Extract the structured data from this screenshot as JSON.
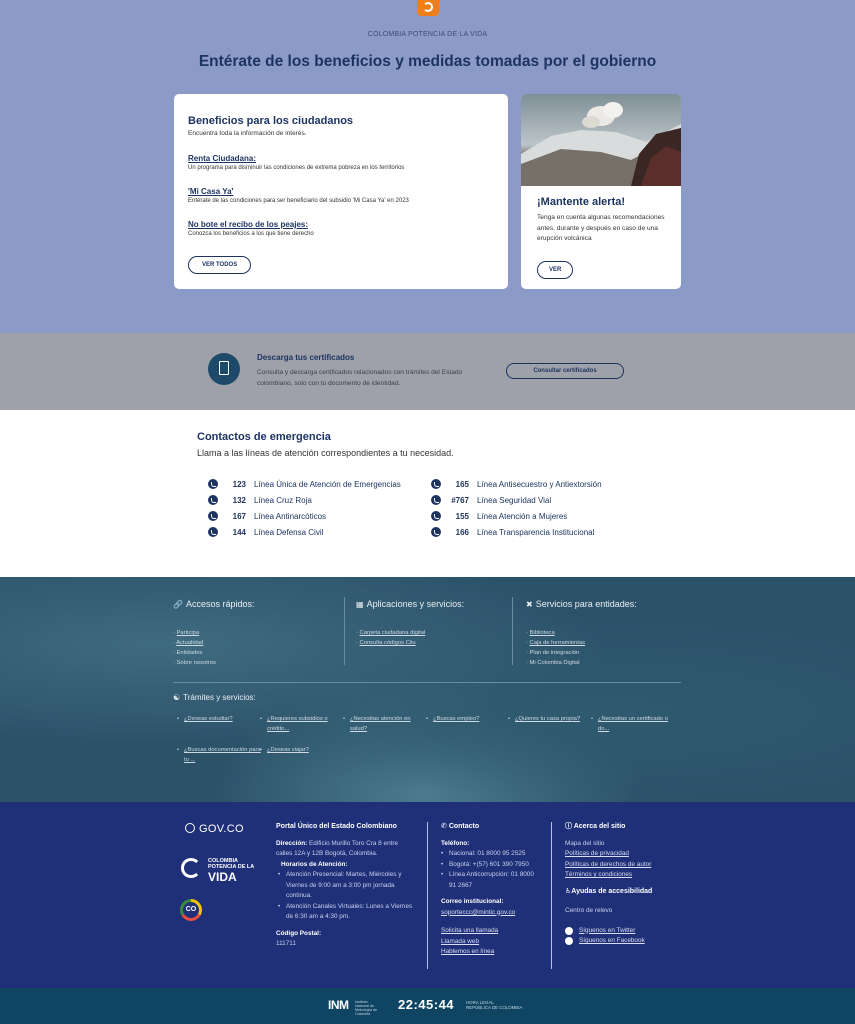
{
  "hero": {
    "tagline": "COLOMBIA POTENCIA DE LA VIDA",
    "title": "Entérate de los beneficios y medidas tomadas por el gobierno"
  },
  "benefits": {
    "title": "Beneficios para los ciudadanos",
    "subtitle": "Encuentra toda la información de interés.",
    "items": [
      {
        "title": "Renta Ciudadana:",
        "desc": "Un programa para disminuir las condiciones de extrema pobreza en los territorios"
      },
      {
        "title": "'Mi Casa Ya'",
        "desc": "Entérate de las condiciones para ser beneficiario del subsidio 'Mi Casa Ya' en 2023"
      },
      {
        "title": "No bote el recibo de los peajes:",
        "desc": "Conozca los beneficios a los que tiene derecho"
      }
    ],
    "button": "VER TODOS"
  },
  "alert": {
    "title": "¡Mantente alerta!",
    "body": "Tenga en cuenta algunas recomendaciones antes, durante y después en caso de una erupción volcánica",
    "button": "VER"
  },
  "certificates": {
    "title": "Descarga tus certificados",
    "body": "Consulta y descarga certificados relacionados con trámites del Estado colombiano, solo con tu documento de identidad.",
    "button": "Consultar certificados"
  },
  "emergency": {
    "title": "Contactos de emergencia",
    "subtitle": "Llama a las líneas de atención correspondientes a tu necesidad.",
    "left": [
      {
        "num": "123",
        "label": "Línea Única de Atención de Emergencias"
      },
      {
        "num": "132",
        "label": "Línea Cruz Roja"
      },
      {
        "num": "167",
        "label": "Línea Antinarcóticos"
      },
      {
        "num": "144",
        "label": "Línea Defensa Civil"
      }
    ],
    "right": [
      {
        "num": "165",
        "label": "Línea Antisecuestro y Antiextorsión"
      },
      {
        "num": "#767",
        "label": "Línea Seguridad Vial"
      },
      {
        "num": "155",
        "label": "Línea Atención a Mujeres"
      },
      {
        "num": "166",
        "label": "Línea Transparencia Institucional"
      }
    ]
  },
  "footer_links": {
    "quick": {
      "title": "Accesos rápidos:",
      "items": [
        "Participa",
        "Actualidad",
        "Entidades",
        "Sobre nosotros"
      ]
    },
    "apps": {
      "title": "Aplicaciones y servicios:",
      "items": [
        "Carpeta ciudadana digital",
        "Consulta códigos Ciiu"
      ]
    },
    "entities": {
      "title": "Servicios para entidades:",
      "items": [
        "Biblioteca",
        "Caja de herramientas",
        "Plan de integración",
        "Mi Colombia Digital"
      ]
    },
    "procedures": {
      "title": "Trámites y servicios:",
      "items": [
        "¿Deseas estudiar?",
        "¿Requieres subsidios o crédito...",
        "¿Necesitas atención en salud?",
        "¿Buscas empleo?",
        "¿Quieres tu casa propia?",
        "¿Necesitas un certificado o do...",
        "¿Buscas documentación para tu ...",
        "¿Deseas viajar?"
      ]
    }
  },
  "gov_footer": {
    "govco": "GOV.CO",
    "colombia_small": "COLOMBIA\nPOTENCIA DE LA",
    "colombia_big": "VIDA",
    "co_badge": "CO",
    "portal_title": "Portal Único del Estado Colombiano",
    "direction_label": "Dirección:",
    "direction": "Edificio Murillo Toro Cra 8 entre calles 12A y 12B Bogotá, Colombia.",
    "hours_label": "Horarios de Atención:",
    "hours": [
      "Atención Presencial: Martes, Miércoles y Viernes de 9:00 am a 3:00 pm jornada continua.",
      "Atención Canales Virtuales: Lunes a Viernes de 6:30 am a 4:30 pm."
    ],
    "postal_label": "Código Postal:",
    "postal": "111711",
    "contact_title": "Contacto",
    "phone_label": "Teléfono:",
    "phones": [
      "Nacional: 01 8000 95 2525",
      "Bogotá: +(57) 601 390 7950",
      "Línea Anticorrupción: 01 8000 91 2667"
    ],
    "email_label": "Correo institucional:",
    "email": "soporteccc@mintic.gov.co",
    "contact_links": [
      "Solicita una llamada",
      "Llamada web",
      "Hablemos en línea"
    ],
    "about_title": "Acerca del sitio",
    "about_items": [
      "Mapa del sitio",
      "Políticas de privacidad",
      "Políticas de derechos de autor",
      "Términos y condiciones"
    ],
    "accessibility": "Ayudas de accesibilidad",
    "relay": "Centro de relevo",
    "twitter": "Síguenos en Twitter",
    "facebook": "Síguenos en Facebook"
  },
  "bottom_bar": {
    "inm": "INM",
    "inm_sub": "Instituto Nacional de Metrología de Colombia",
    "time": "22:45:44",
    "time_sub": "HORA LEGAL\nREPÚBLICA DE COLOMBIA"
  }
}
